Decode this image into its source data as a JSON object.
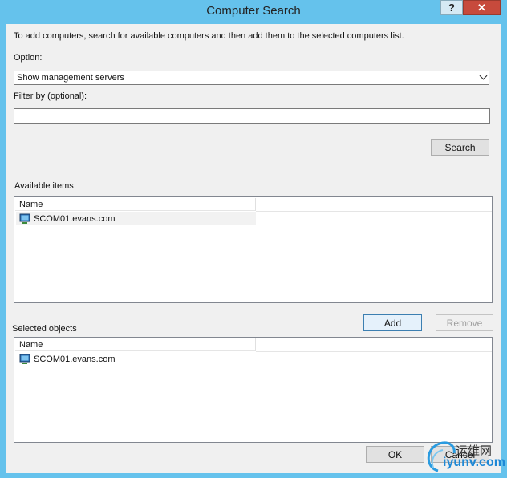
{
  "window": {
    "title": "Computer Search",
    "help_glyph": "?",
    "close_glyph": "✕"
  },
  "instructions": "To add computers, search for available computers and then add them to the selected computers list.",
  "option": {
    "label": "Option:",
    "selected": "Show management servers"
  },
  "filter": {
    "label": "Filter by (optional):",
    "value": ""
  },
  "search_button": "Search",
  "available": {
    "label": "Available items",
    "column": "Name",
    "items": [
      {
        "name": "SCOM01.evans.com",
        "icon": "computer-icon"
      }
    ]
  },
  "add_button": "Add",
  "remove_button": "Remove",
  "selected": {
    "label": "Selected objects",
    "column": "Name",
    "items": [
      {
        "name": "SCOM01.evans.com",
        "icon": "computer-icon"
      }
    ]
  },
  "ok_button": "OK",
  "cancel_button": "Cancel",
  "watermark": {
    "line1": "运维网",
    "line2": "iyunv.com"
  }
}
